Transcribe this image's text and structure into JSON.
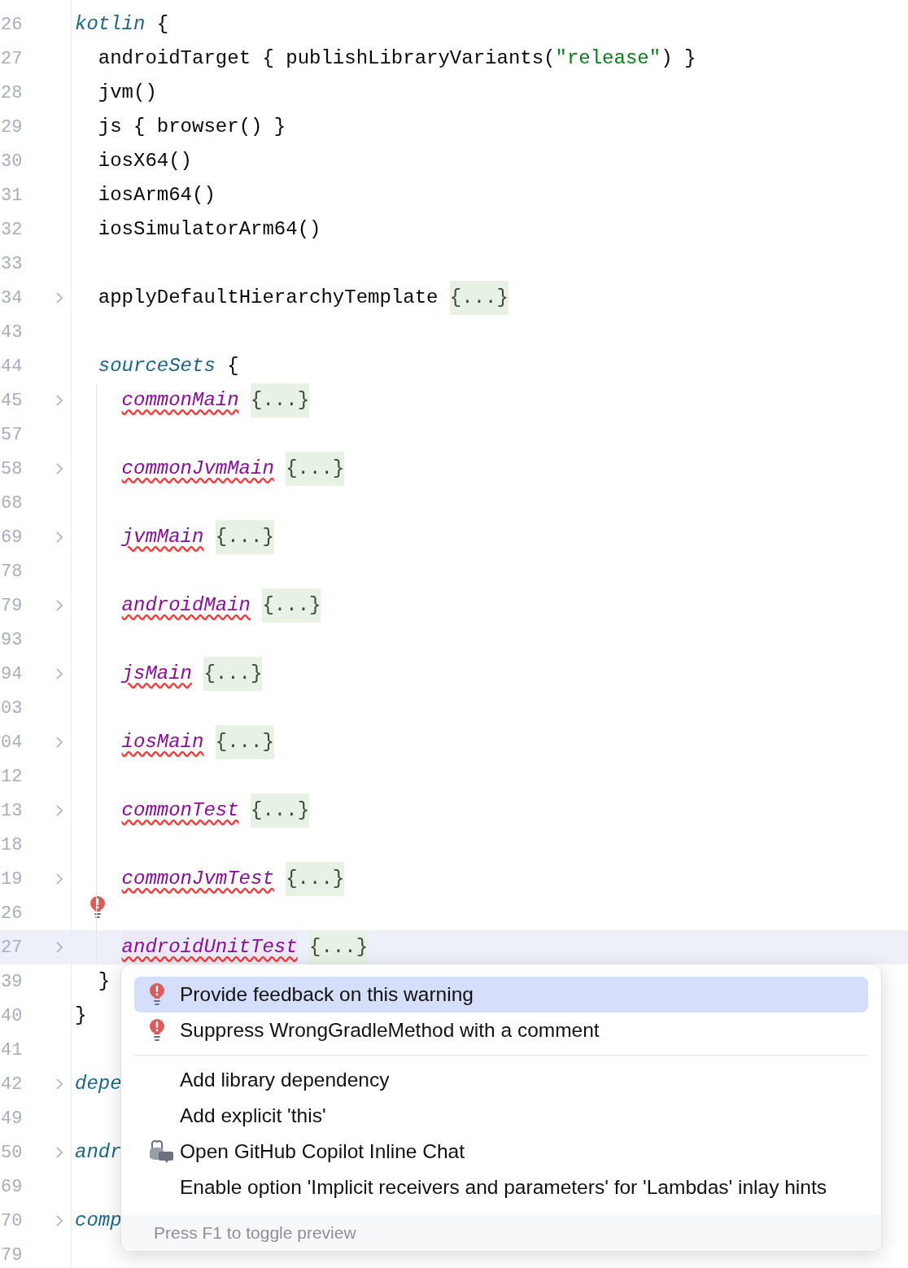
{
  "editor": {
    "lines": [
      {
        "number": "26",
        "kind": "outer",
        "fold": false,
        "current": false,
        "bulb": false,
        "tokens": [
          {
            "kind": "keyword",
            "text": "kotlin"
          },
          {
            "kind": "plain",
            "text": " {"
          }
        ]
      },
      {
        "number": "27",
        "kind": "inner",
        "fold": false,
        "current": false,
        "bulb": false,
        "tokens": [
          {
            "kind": "plain",
            "text": "androidTarget { publishLibraryVariants("
          },
          {
            "kind": "string",
            "text": "\"release\""
          },
          {
            "kind": "plain",
            "text": ") }"
          }
        ]
      },
      {
        "number": "28",
        "kind": "inner",
        "fold": false,
        "current": false,
        "bulb": false,
        "tokens": [
          {
            "kind": "plain",
            "text": "jvm()"
          }
        ]
      },
      {
        "number": "29",
        "kind": "inner",
        "fold": false,
        "current": false,
        "bulb": false,
        "tokens": [
          {
            "kind": "plain",
            "text": "js { browser() }"
          }
        ]
      },
      {
        "number": "30",
        "kind": "inner",
        "fold": false,
        "current": false,
        "bulb": false,
        "tokens": [
          {
            "kind": "plain",
            "text": "iosX64()"
          }
        ]
      },
      {
        "number": "31",
        "kind": "inner",
        "fold": false,
        "current": false,
        "bulb": false,
        "tokens": [
          {
            "kind": "plain",
            "text": "iosArm64()"
          }
        ]
      },
      {
        "number": "32",
        "kind": "inner",
        "fold": false,
        "current": false,
        "bulb": false,
        "tokens": [
          {
            "kind": "plain",
            "text": "iosSimulatorArm64()"
          }
        ]
      },
      {
        "number": "33",
        "kind": "inner",
        "fold": false,
        "current": false,
        "bulb": false
      },
      {
        "number": "34",
        "kind": "inner",
        "fold": true,
        "current": false,
        "bulb": false,
        "tokens": [
          {
            "kind": "plain",
            "text": "applyDefaultHierarchyTemplate"
          },
          {
            "kind": "folded",
            "text": "{...}"
          }
        ]
      },
      {
        "number": "43",
        "kind": "inner",
        "fold": false,
        "current": false,
        "bulb": false
      },
      {
        "number": "44",
        "kind": "inner",
        "fold": false,
        "current": false,
        "bulb": false,
        "tokens": [
          {
            "kind": "keyword",
            "text": "sourceSets"
          },
          {
            "kind": "plain",
            "text": " {"
          }
        ]
      },
      {
        "number": "45",
        "kind": "innermost",
        "fold": true,
        "current": false,
        "bulb": false,
        "tokens": [
          {
            "kind": "sourceset",
            "text": "commonMain"
          },
          {
            "kind": "folded",
            "text": "{...}"
          }
        ]
      },
      {
        "number": "57",
        "kind": "innermost",
        "fold": false,
        "current": false,
        "bulb": false
      },
      {
        "number": "58",
        "kind": "innermost",
        "fold": true,
        "current": false,
        "bulb": false,
        "tokens": [
          {
            "kind": "sourceset",
            "text": "commonJvmMain"
          },
          {
            "kind": "folded",
            "text": "{...}"
          }
        ]
      },
      {
        "number": "68",
        "kind": "innermost",
        "fold": false,
        "current": false,
        "bulb": false
      },
      {
        "number": "69",
        "kind": "innermost",
        "fold": true,
        "current": false,
        "bulb": false,
        "tokens": [
          {
            "kind": "sourceset",
            "text": "jvmMain"
          },
          {
            "kind": "folded",
            "text": "{...}"
          }
        ]
      },
      {
        "number": "78",
        "kind": "innermost",
        "fold": false,
        "current": false,
        "bulb": false
      },
      {
        "number": "79",
        "kind": "innermost",
        "fold": true,
        "current": false,
        "bulb": false,
        "tokens": [
          {
            "kind": "sourceset",
            "text": "androidMain"
          },
          {
            "kind": "folded",
            "text": "{...}"
          }
        ]
      },
      {
        "number": "93",
        "kind": "innermost",
        "fold": false,
        "current": false,
        "bulb": false
      },
      {
        "number": "94",
        "kind": "innermost",
        "fold": true,
        "current": false,
        "bulb": false,
        "tokens": [
          {
            "kind": "sourceset",
            "text": "jsMain"
          },
          {
            "kind": "folded",
            "text": "{...}"
          }
        ]
      },
      {
        "number": "03",
        "kind": "innermost",
        "fold": false,
        "current": false,
        "bulb": false
      },
      {
        "number": "04",
        "kind": "innermost",
        "fold": true,
        "current": false,
        "bulb": false,
        "tokens": [
          {
            "kind": "sourceset",
            "text": "iosMain"
          },
          {
            "kind": "folded",
            "text": "{...}"
          }
        ]
      },
      {
        "number": "12",
        "kind": "innermost",
        "fold": false,
        "current": false,
        "bulb": false
      },
      {
        "number": "13",
        "kind": "innermost",
        "fold": true,
        "current": false,
        "bulb": false,
        "tokens": [
          {
            "kind": "sourceset",
            "text": "commonTest"
          },
          {
            "kind": "folded",
            "text": "{...}"
          }
        ]
      },
      {
        "number": "18",
        "kind": "innermost",
        "fold": false,
        "current": false,
        "bulb": false
      },
      {
        "number": "19",
        "kind": "innermost",
        "fold": true,
        "current": false,
        "bulb": false,
        "tokens": [
          {
            "kind": "sourceset",
            "text": "commonJvmTest"
          },
          {
            "kind": "folded",
            "text": "{...}"
          }
        ]
      },
      {
        "number": "26",
        "kind": "innermost",
        "fold": false,
        "current": false,
        "bulb": true
      },
      {
        "number": "27",
        "kind": "innermost",
        "fold": true,
        "current": true,
        "bulb": false,
        "tokens": [
          {
            "kind": "sourceset-marked",
            "text": "androidUnitTest"
          },
          {
            "kind": "folded",
            "text": "{...}"
          }
        ]
      },
      {
        "number": "39",
        "kind": "inner",
        "fold": false,
        "current": false,
        "bulb": false,
        "tokens": [
          {
            "kind": "plain",
            "text": "}"
          }
        ]
      },
      {
        "number": "40",
        "kind": "outer",
        "fold": false,
        "current": false,
        "bulb": false,
        "tokens": [
          {
            "kind": "plain",
            "text": "}"
          }
        ]
      },
      {
        "number": "41",
        "kind": "outer",
        "fold": false,
        "current": false,
        "bulb": false
      },
      {
        "number": "42",
        "kind": "outer",
        "fold": true,
        "current": false,
        "bulb": false,
        "tokens": [
          {
            "kind": "keyword",
            "text": "depe"
          }
        ]
      },
      {
        "number": "49",
        "kind": "outer",
        "fold": false,
        "current": false,
        "bulb": false
      },
      {
        "number": "50",
        "kind": "outer",
        "fold": true,
        "current": false,
        "bulb": false,
        "tokens": [
          {
            "kind": "keyword",
            "text": "andr"
          }
        ]
      },
      {
        "number": "69",
        "kind": "outer",
        "fold": false,
        "current": false,
        "bulb": false
      },
      {
        "number": "70",
        "kind": "outer",
        "fold": true,
        "current": false,
        "bulb": false,
        "tokens": [
          {
            "kind": "keyword",
            "text": "comp"
          }
        ]
      },
      {
        "number": "79",
        "kind": "outer",
        "fold": false,
        "current": false,
        "bulb": false
      }
    ]
  },
  "popup": {
    "groups": [
      [
        {
          "kind": "warning",
          "label": "Provide feedback on this warning",
          "selected": true
        },
        {
          "kind": "warning",
          "label": "Suppress WrongGradleMethod with a comment",
          "selected": false
        }
      ],
      [
        {
          "kind": "plain",
          "label": "Add library dependency",
          "selected": false
        },
        {
          "kind": "plain",
          "label": "Add explicit 'this'",
          "selected": false
        },
        {
          "kind": "copilot",
          "label": "Open GitHub Copilot Inline Chat",
          "selected": false
        },
        {
          "kind": "plain",
          "label": "Enable option 'Implicit receivers and parameters' for 'Lambdas' inlay hints",
          "selected": false
        }
      ]
    ],
    "footer": "Press F1 to toggle preview"
  }
}
